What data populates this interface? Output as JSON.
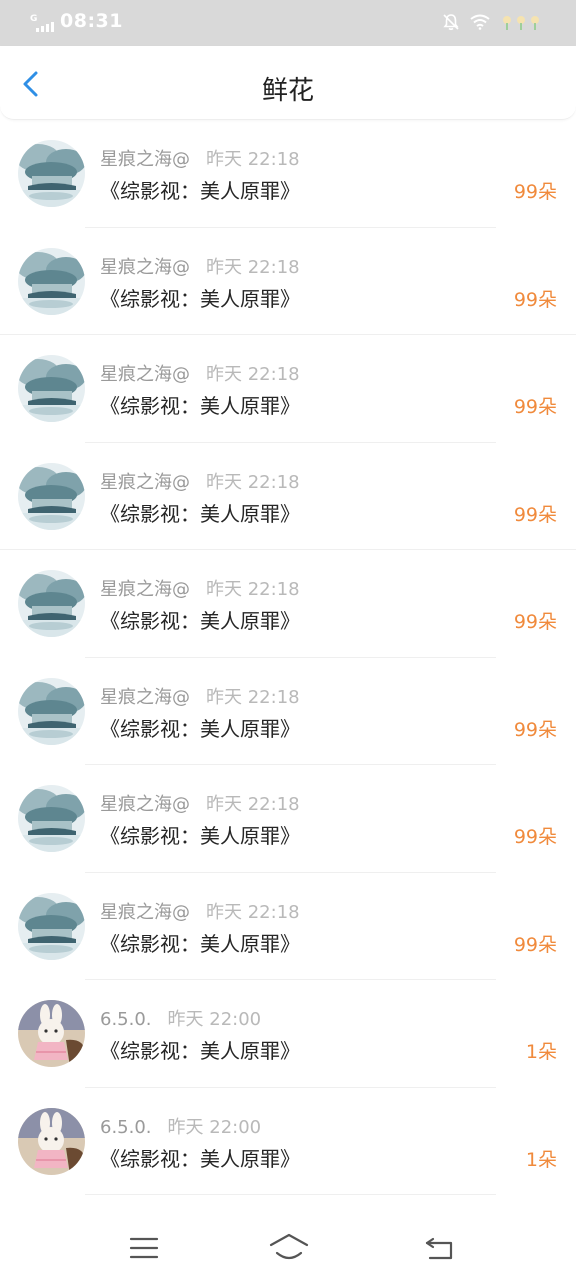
{
  "status_bar": {
    "time": "08:31",
    "network": "G",
    "icons": [
      "bell-off-icon",
      "wifi-icon",
      "flower-icon",
      "flower-icon",
      "flower-icon"
    ]
  },
  "header": {
    "title": "鲜花",
    "back_icon": "chevron-left-icon",
    "accent_color": "#2f8fe6"
  },
  "entries": [
    {
      "user": "星痕之海@",
      "time": "昨天 22:18",
      "book": "《综影视：美人原罪》",
      "count": "99朵",
      "avatar": "landscape"
    },
    {
      "user": "星痕之海@",
      "time": "昨天 22:18",
      "book": "《综影视：美人原罪》",
      "count": "99朵",
      "avatar": "landscape"
    },
    {
      "user": "星痕之海@",
      "time": "昨天 22:18",
      "book": "《综影视：美人原罪》",
      "count": "99朵",
      "avatar": "landscape"
    },
    {
      "user": "星痕之海@",
      "time": "昨天 22:18",
      "book": "《综影视：美人原罪》",
      "count": "99朵",
      "avatar": "landscape"
    },
    {
      "user": "星痕之海@",
      "time": "昨天 22:18",
      "book": "《综影视：美人原罪》",
      "count": "99朵",
      "avatar": "landscape"
    },
    {
      "user": "星痕之海@",
      "time": "昨天 22:18",
      "book": "《综影视：美人原罪》",
      "count": "99朵",
      "avatar": "landscape"
    },
    {
      "user": "星痕之海@",
      "time": "昨天 22:18",
      "book": "《综影视：美人原罪》",
      "count": "99朵",
      "avatar": "landscape"
    },
    {
      "user": "星痕之海@",
      "time": "昨天 22:18",
      "book": "《综影视：美人原罪》",
      "count": "99朵",
      "avatar": "landscape"
    },
    {
      "user": "6.5.0.",
      "time": "昨天 22:00",
      "book": "《综影视：美人原罪》",
      "count": "1朵",
      "avatar": "bunny"
    },
    {
      "user": "6.5.0.",
      "time": "昨天 22:00",
      "book": "《综影视：美人原罪》",
      "count": "1朵",
      "avatar": "bunny"
    }
  ],
  "colors": {
    "count": "#f08a3c",
    "username": "#9a9a9a",
    "book": "#262626"
  },
  "bottom_nav": {
    "icons": [
      "menu-icon",
      "home-icon",
      "back-icon"
    ]
  }
}
